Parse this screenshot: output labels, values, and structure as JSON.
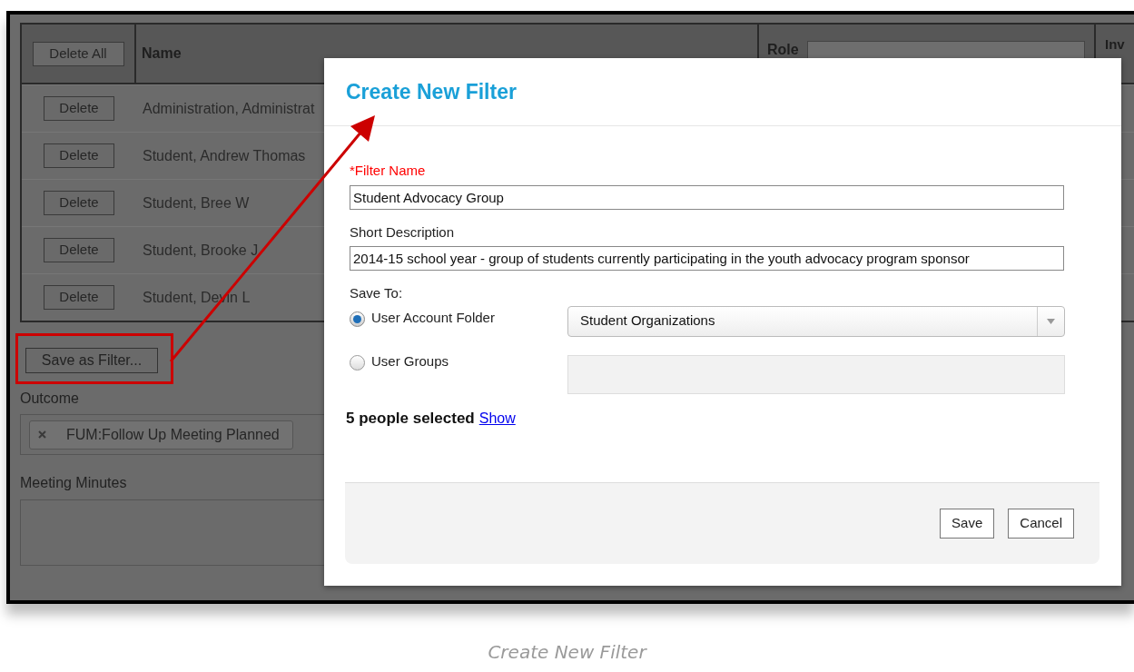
{
  "table": {
    "delete_all": "Delete All",
    "columns": [
      "Name",
      "Role",
      "Inv"
    ],
    "rows": [
      {
        "action": "Delete",
        "name": "Administration, Administrat"
      },
      {
        "action": "Delete",
        "name": "Student, Andrew Thomas"
      },
      {
        "action": "Delete",
        "name": "Student, Bree W"
      },
      {
        "action": "Delete",
        "name": "Student, Brooke J"
      },
      {
        "action": "Delete",
        "name": "Student, Devin L"
      }
    ]
  },
  "save_filter_button": "Save as Filter...",
  "outcome": {
    "label": "Outcome",
    "chip": "FUM:Follow Up Meeting Planned"
  },
  "meeting_minutes": {
    "label": "Meeting Minutes"
  },
  "dialog": {
    "title": "Create New Filter",
    "fields": [
      {
        "label": "*Filter Name",
        "required": true,
        "value": "Student Advocacy Group"
      },
      {
        "label": "Short Description",
        "required": false,
        "value": "2014-15 school year - group of students currently participating in the youth advocacy program sponsor"
      }
    ],
    "save_to": {
      "label": "Save To:",
      "options": [
        {
          "label": "User Account Folder",
          "selected": true,
          "kind": "dropdown",
          "value": "Student Organizations"
        },
        {
          "label": "User Groups",
          "selected": false,
          "kind": "box"
        }
      ]
    },
    "selection_count": "5 people selected",
    "show_link": "Show",
    "buttons": [
      "Save",
      "Cancel"
    ]
  },
  "caption": "Create New Filter"
}
